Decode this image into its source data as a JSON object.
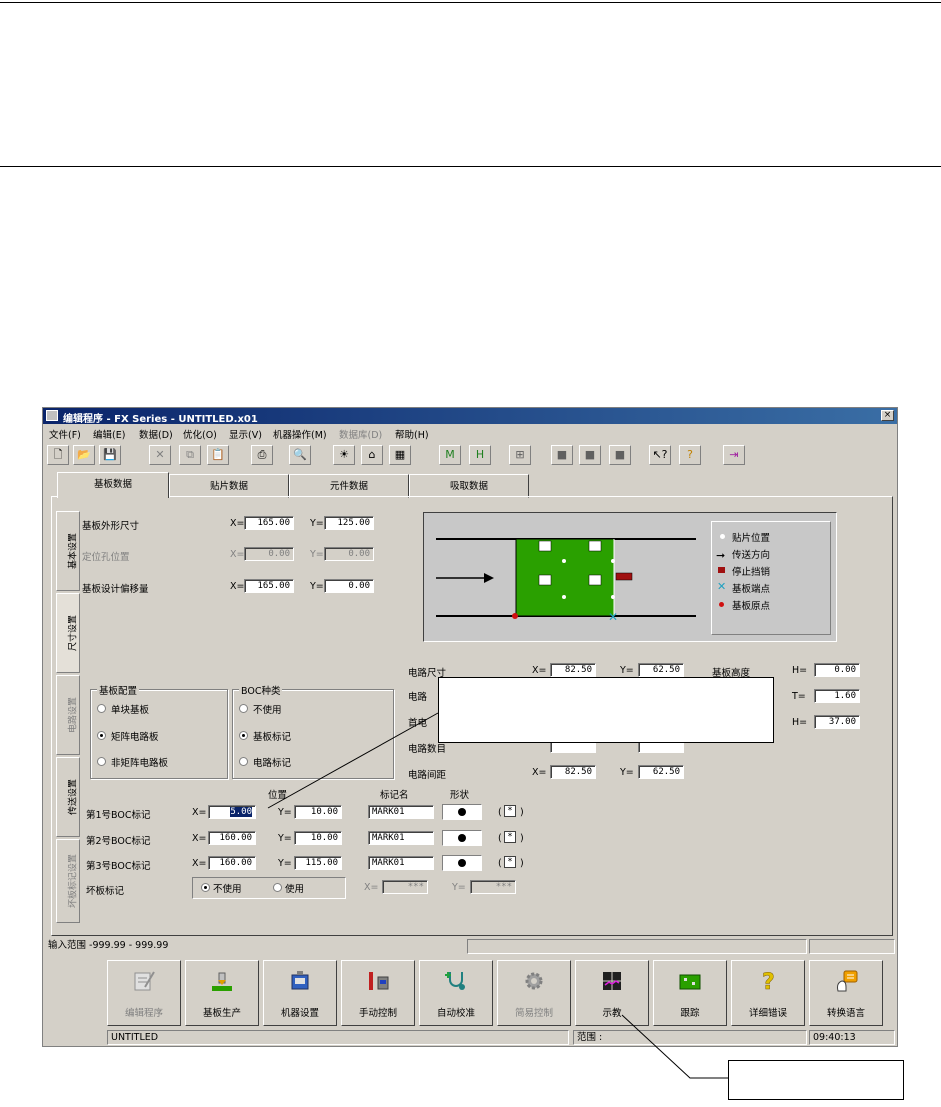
{
  "window": {
    "title": "编辑程序 - FX Series - UNTITLED.x01",
    "close": "×"
  },
  "menu": [
    "文件(F)",
    "编辑(E)",
    "数据(D)",
    "优化(O)",
    "显示(V)",
    "机器操作(M)",
    "数据库(D)",
    "帮助(H)"
  ],
  "tabs_top": [
    "基板数据",
    "贴片数据",
    "元件数据",
    "吸取数据"
  ],
  "tabs_side": [
    "基本设置",
    "尺寸设置",
    "电路设置",
    "传送设置",
    "坏板标记设置"
  ],
  "board": {
    "outline_label": "基板外形尺寸",
    "outline_x": "165.00",
    "outline_y": "125.00",
    "hole_label": "定位孔位置",
    "hole_x": "0.00",
    "hole_y": "0.00",
    "offset_label": "基板设计偏移量",
    "offset_x": "165.00",
    "offset_y": "0.00",
    "x_eq": "X=",
    "y_eq": "Y="
  },
  "legend": {
    "mount": "贴片位置",
    "direction": "传送方向",
    "stopper": "停止挡销",
    "corner": "基板端点",
    "origin": "基板原点"
  },
  "circuit": {
    "size_label": "电路尺寸",
    "size_x": "82.50",
    "size_y": "62.50",
    "row2_label": "电路",
    "row3_label": "首电",
    "row4_label": "电路数目",
    "pitch_label": "电路间距",
    "pitch_x": "82.50",
    "pitch_y": "62.50"
  },
  "height": {
    "board_h_label": "基板高度",
    "h_eq": "H=",
    "h_val": "0.00",
    "t_eq": "T=",
    "t_val": "1.60",
    "h2_eq": "H=",
    "h2_val": "37.00"
  },
  "layout_group": {
    "title": "基板配置",
    "opt1": "单块基板",
    "opt2": "矩阵电路板",
    "opt3": "非矩阵电路板",
    "selected": 2
  },
  "boc_group": {
    "title": "BOC种类",
    "opt1": "不使用",
    "opt2": "基板标记",
    "opt3": "电路标记",
    "selected": 2
  },
  "boc": {
    "pos_header": "位置",
    "name_header": "标记名",
    "shape_header": "形状",
    "rows": [
      {
        "label": "第1号BOC标记",
        "x": "5.00",
        "y": "10.00",
        "name": "MARK01",
        "chk": "*"
      },
      {
        "label": "第2号BOC标记",
        "x": "160.00",
        "y": "10.00",
        "name": "MARK01",
        "chk": "*"
      },
      {
        "label": "第3号BOC标记",
        "x": "160.00",
        "y": "115.00",
        "name": "MARK01",
        "chk": "*"
      }
    ],
    "paren_open": "(",
    "paren_close": ")"
  },
  "bad_mark": {
    "label": "坏板标记",
    "opt1": "不使用",
    "opt2": "使用",
    "selected": 1,
    "x_val": "***",
    "y_val": "***"
  },
  "status": {
    "range": "输入范围 -999.99 - 999.99",
    "file": "UNTITLED",
    "scope": "范围 :",
    "time": "09:40:13"
  },
  "big_buttons": [
    {
      "label": "编辑程序",
      "enabled": false,
      "icon": "edit-icon"
    },
    {
      "label": "基板生产",
      "enabled": true,
      "icon": "production-icon"
    },
    {
      "label": "机器设置",
      "enabled": true,
      "icon": "machine-icon"
    },
    {
      "label": "手动控制",
      "enabled": true,
      "icon": "manual-icon"
    },
    {
      "label": "自动校准",
      "enabled": true,
      "icon": "calibrate-icon"
    },
    {
      "label": "简易控制",
      "enabled": false,
      "icon": "gear-icon"
    },
    {
      "label": "示教",
      "enabled": true,
      "icon": "teach-icon"
    },
    {
      "label": "跟踪",
      "enabled": true,
      "icon": "trace-icon"
    },
    {
      "label": "详细错误",
      "enabled": true,
      "icon": "help-icon"
    },
    {
      "label": "转换语言",
      "enabled": true,
      "icon": "language-icon"
    }
  ],
  "colors": {
    "board_green": "#2aa000",
    "titlebar": "#0a246a",
    "face": "#d4d0c8"
  }
}
